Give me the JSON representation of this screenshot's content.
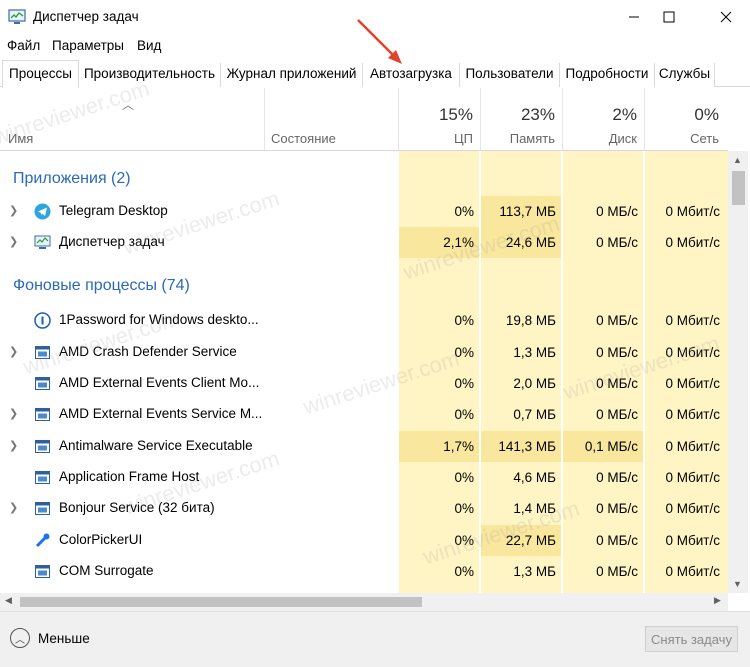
{
  "window": {
    "title": "Диспетчер задач"
  },
  "menu": [
    "Файл",
    "Параметры",
    "Вид"
  ],
  "tabs": [
    "Процессы",
    "Производительность",
    "Журнал приложений",
    "Автозагрузка",
    "Пользователи",
    "Подробности",
    "Службы"
  ],
  "columns": {
    "name": "Имя",
    "status": "Состояние",
    "cpu": {
      "pct": "15%",
      "label": "ЦП"
    },
    "mem": {
      "pct": "23%",
      "label": "Память"
    },
    "disk": {
      "pct": "2%",
      "label": "Диск"
    },
    "net": {
      "pct": "0%",
      "label": "Сеть"
    }
  },
  "groups": {
    "apps": "Приложения (2)",
    "background": "Фоновые процессы (74)"
  },
  "rows": [
    {
      "name": "Telegram Desktop",
      "cpu": "0%",
      "mem": "113,7 МБ",
      "disk": "0 МБ/с",
      "net": "0 Мбит/с",
      "icon": "telegram-icon",
      "expand": true
    },
    {
      "name": "Диспетчер задач",
      "cpu": "2,1%",
      "mem": "24,6 МБ",
      "disk": "0 МБ/с",
      "net": "0 Мбит/с",
      "icon": "task-manager-icon",
      "expand": true
    },
    {
      "name": "1Password for Windows deskto...",
      "cpu": "0%",
      "mem": "19,8 МБ",
      "disk": "0 МБ/с",
      "net": "0 Мбит/с",
      "icon": "onepassword-icon",
      "expand": false
    },
    {
      "name": "AMD Crash Defender Service",
      "cpu": "0%",
      "mem": "1,3 МБ",
      "disk": "0 МБ/с",
      "net": "0 Мбит/с",
      "icon": "service-icon",
      "expand": true
    },
    {
      "name": "AMD External Events Client Mo...",
      "cpu": "0%",
      "mem": "2,0 МБ",
      "disk": "0 МБ/с",
      "net": "0 Мбит/с",
      "icon": "service-icon",
      "expand": false
    },
    {
      "name": "AMD External Events Service M...",
      "cpu": "0%",
      "mem": "0,7 МБ",
      "disk": "0 МБ/с",
      "net": "0 Мбит/с",
      "icon": "service-icon",
      "expand": true
    },
    {
      "name": "Antimalware Service Executable",
      "cpu": "1,7%",
      "mem": "141,3 МБ",
      "disk": "0,1 МБ/с",
      "net": "0 Мбит/с",
      "icon": "service-icon",
      "expand": true
    },
    {
      "name": "Application Frame Host",
      "cpu": "0%",
      "mem": "4,6 МБ",
      "disk": "0 МБ/с",
      "net": "0 Мбит/с",
      "icon": "service-icon",
      "expand": false
    },
    {
      "name": "Bonjour Service (32 бита)",
      "cpu": "0%",
      "mem": "1,4 МБ",
      "disk": "0 МБ/с",
      "net": "0 Мбит/с",
      "icon": "service-icon",
      "expand": true
    },
    {
      "name": "ColorPickerUI",
      "cpu": "0%",
      "mem": "22,7 МБ",
      "disk": "0 МБ/с",
      "net": "0 Мбит/с",
      "icon": "colorpicker-icon",
      "expand": false
    },
    {
      "name": "COM Surrogate",
      "cpu": "0%",
      "mem": "1,3 МБ",
      "disk": "0 МБ/с",
      "net": "0 Мбит/с",
      "icon": "service-icon",
      "expand": false
    }
  ],
  "footer": {
    "less": "Меньше",
    "end_task": "Снять задачу"
  },
  "watermark": "winreviewer.com",
  "colors": {
    "accent": "#2a6ab8",
    "heat_light": "#fff4c4",
    "heat_dark": "#f9e79e",
    "annotation_arrow": "#e0442c"
  }
}
